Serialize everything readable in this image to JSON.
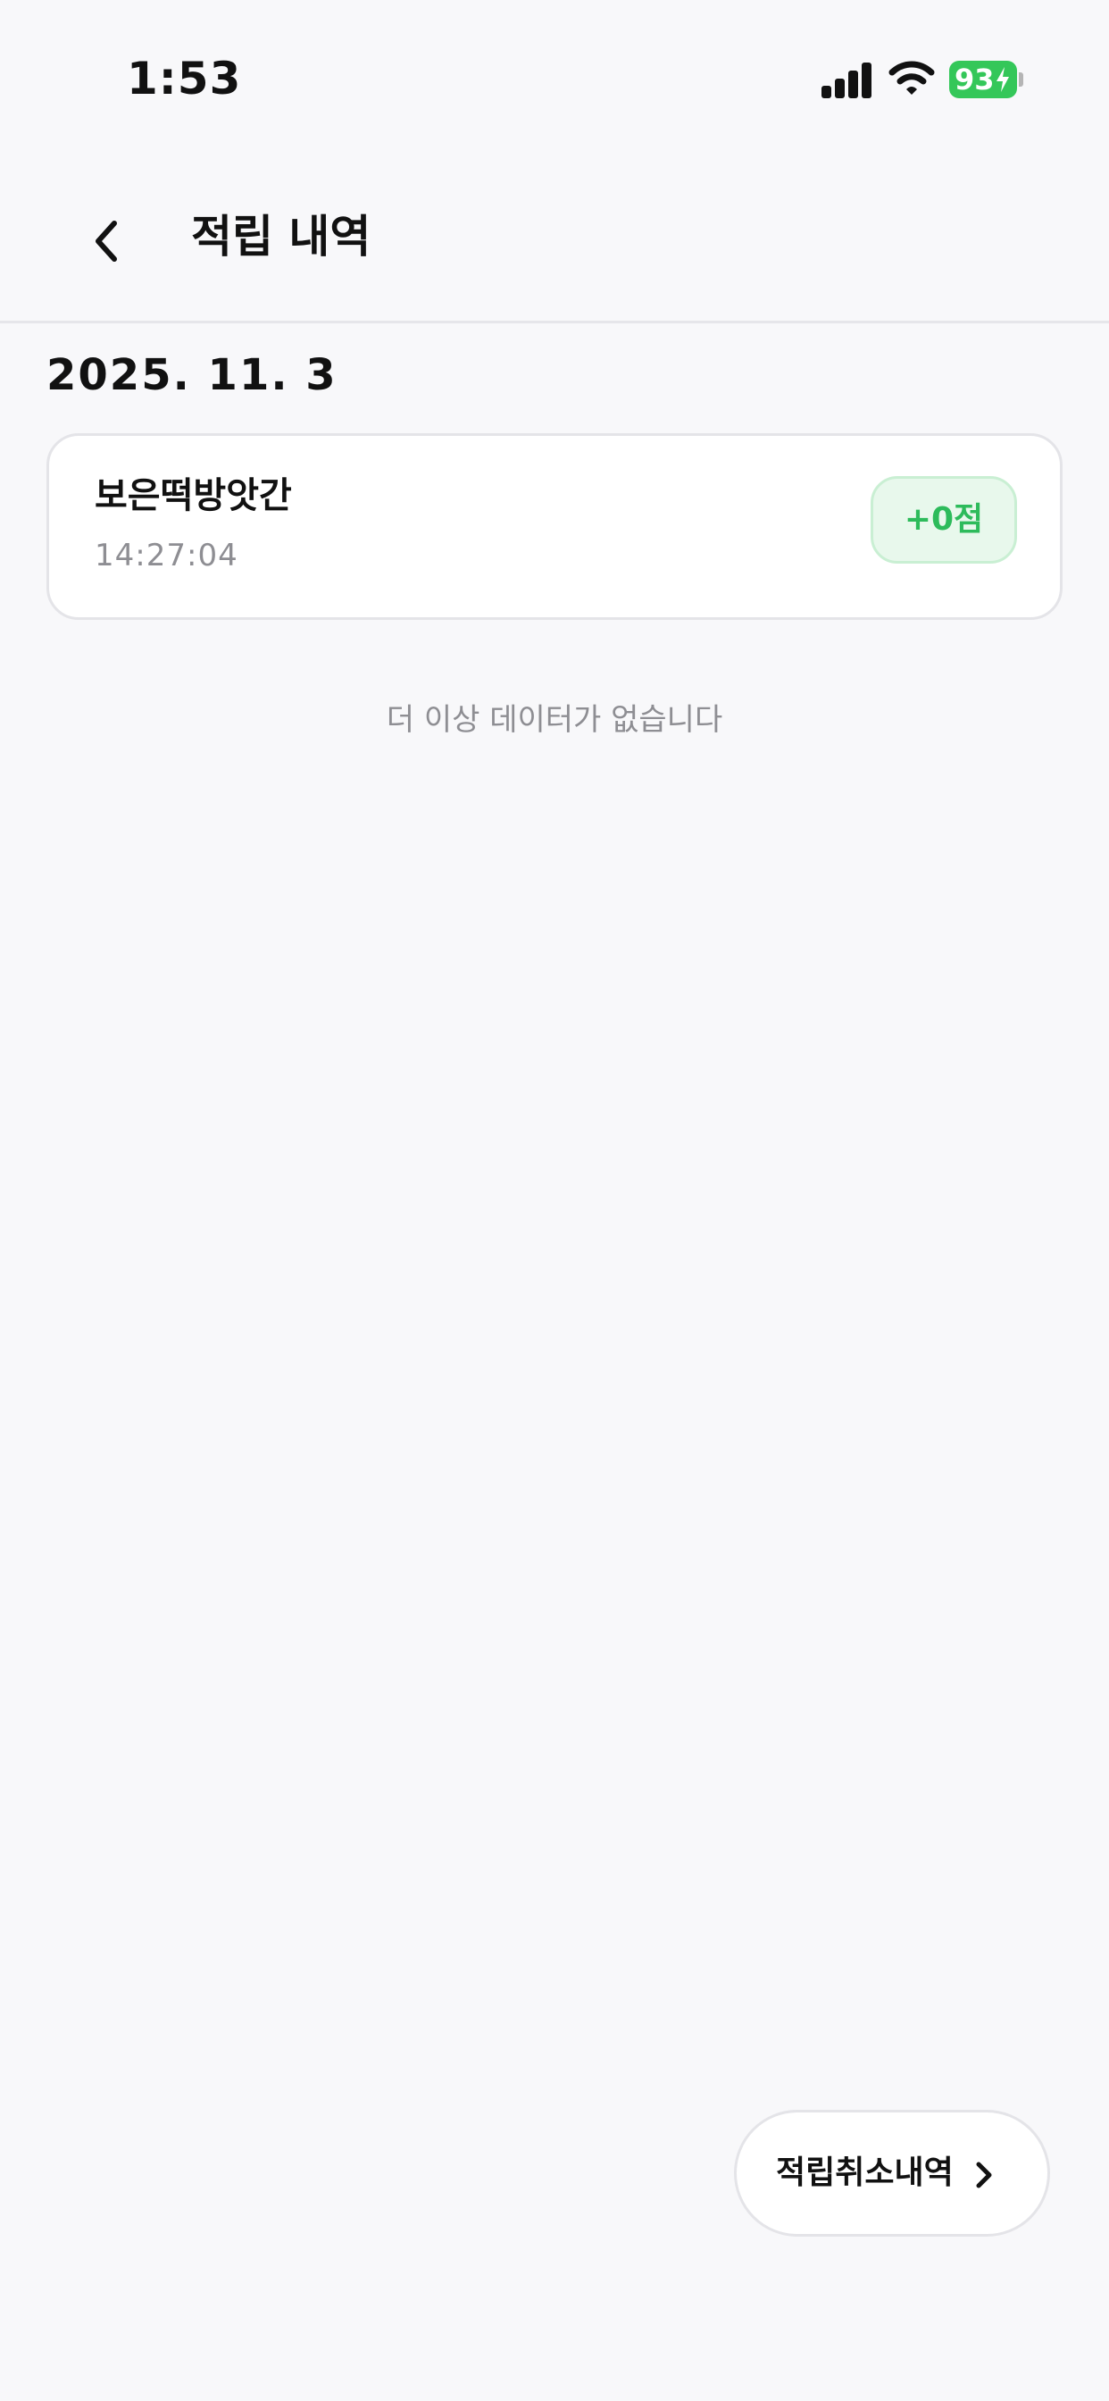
{
  "status_bar": {
    "time": "1:53",
    "battery_level": "93",
    "battery_color": "#34c759"
  },
  "header": {
    "back_icon": "chevron-left-icon",
    "title": "적립 내역"
  },
  "history": {
    "date": "2025. 11. 3",
    "items": [
      {
        "store_name": "보은떡방앗간",
        "time": "14:27:04",
        "points": "+0점",
        "points_color": "#2dbb5b"
      }
    ],
    "empty_message": "더 이상 데이터가 없습니다"
  },
  "footer": {
    "cancel_history_label": "적립취소내역",
    "cancel_history_icon": "chevron-right-icon"
  }
}
